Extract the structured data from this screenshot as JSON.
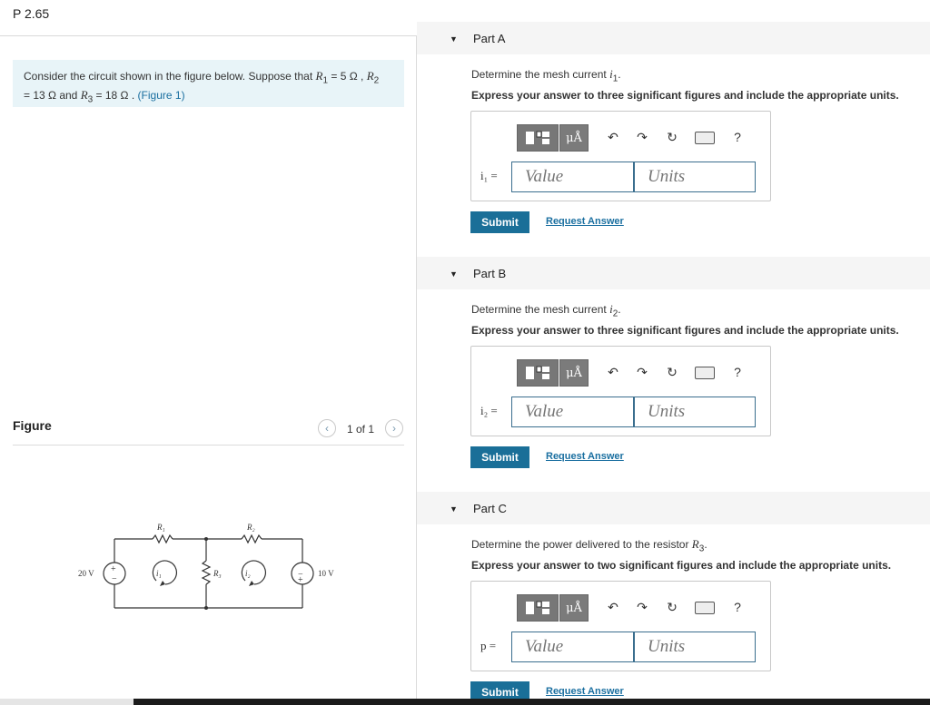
{
  "problem_id": "P 2.65",
  "intro": {
    "line1_prefix": "Consider the circuit shown in the figure below. Suppose that ",
    "r1": "R",
    "r1_sub": "1",
    "r1_val": " = 5 Ω ,",
    "r2": "R",
    "r2_sub": "2",
    "line2_prefix": "= 13 Ω and ",
    "r3": "R",
    "r3_sub": "3",
    "r3_val": " = 18 Ω .",
    "figure_link": "(Figure 1)"
  },
  "figure": {
    "label": "Figure",
    "counter": "1 of 1",
    "prev_glyph": "‹",
    "next_glyph": "›",
    "circuit": {
      "source_left": "20 V",
      "source_right": "10 V",
      "r1": "R₁",
      "r2": "R₂",
      "r3": "R₃",
      "i1": "i₁",
      "i2": "i₂",
      "plus": "+",
      "minus": "−"
    }
  },
  "toolbar": {
    "mu_label": "μÅ",
    "undo_glyph": "↶",
    "redo_glyph": "↷",
    "reset_glyph": "↻",
    "help_glyph": "?"
  },
  "parts": [
    {
      "title": "Part A",
      "question_prefix": "Determine the mesh current ",
      "question_var": "i",
      "question_sub": "1",
      "question_suffix": ".",
      "instruction": "Express your answer to three significant figures and include the appropriate units.",
      "eq_label": "i₁ =",
      "value_placeholder": "Value",
      "units_placeholder": "Units",
      "submit": "Submit",
      "request": "Request Answer"
    },
    {
      "title": "Part B",
      "question_prefix": "Determine the mesh current ",
      "question_var": "i",
      "question_sub": "2",
      "question_suffix": ".",
      "instruction": "Express your answer to three significant figures and include the appropriate units.",
      "eq_label": "i₂ =",
      "value_placeholder": "Value",
      "units_placeholder": "Units",
      "submit": "Submit",
      "request": "Request Answer"
    },
    {
      "title": "Part C",
      "question_prefix": "Determine the power delivered to the resistor ",
      "question_var": "R",
      "question_sub": "3",
      "question_suffix": ".",
      "instruction": "Express your answer to two significant figures and include the appropriate units.",
      "eq_label": "p =",
      "value_placeholder": "Value",
      "units_placeholder": "Units",
      "submit": "Submit",
      "request": "Request Answer"
    }
  ]
}
